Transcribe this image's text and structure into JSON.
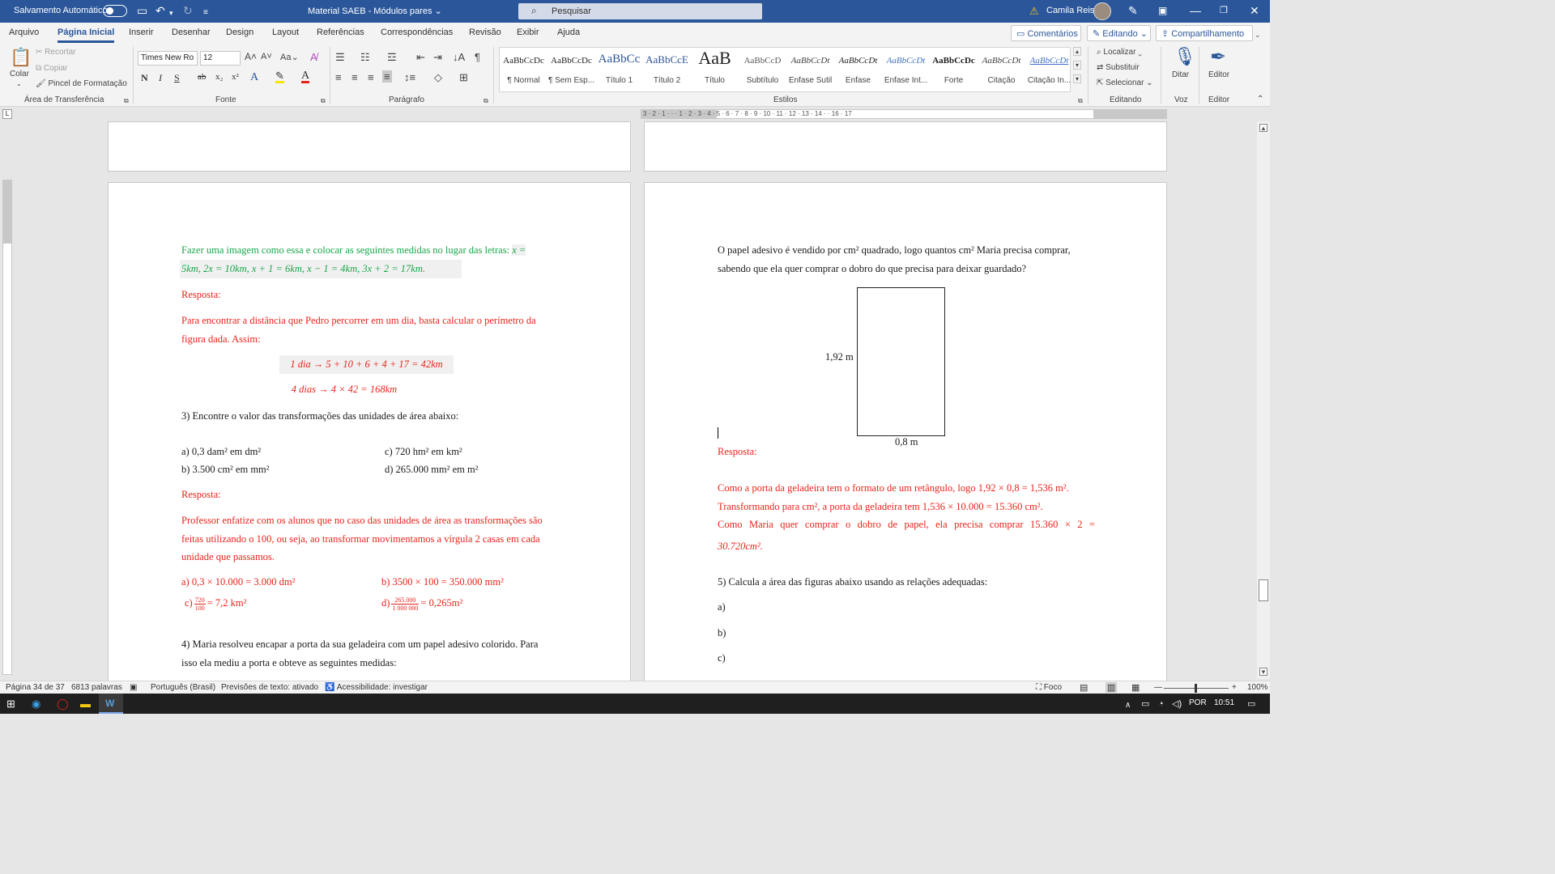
{
  "titlebar": {
    "autosave_label": "Salvamento Automático",
    "doc_title": "Material SAEB - Módulos pares",
    "search_placeholder": "Pesquisar",
    "user_name": "Camila Reis"
  },
  "menu": {
    "tabs": [
      "Arquivo",
      "Página Inicial",
      "Inserir",
      "Desenhar",
      "Design",
      "Layout",
      "Referências",
      "Correspondências",
      "Revisão",
      "Exibir",
      "Ajuda"
    ],
    "comments_label": "Comentários",
    "editing_label": "Editando",
    "share_label": "Compartilhamento"
  },
  "ribbon": {
    "clipboard": {
      "paste": "Colar",
      "cut": "Recortar",
      "copy": "Copiar",
      "format_painter": "Pincel de Formatação",
      "group": "Área de Transferência"
    },
    "font": {
      "family": "Times New Ro",
      "size": "12",
      "group": "Fonte"
    },
    "paragraph": {
      "group": "Parágrafo"
    },
    "styles": {
      "group": "Estilos",
      "items": [
        {
          "preview": "AaBbCcDc",
          "name": "¶ Normal"
        },
        {
          "preview": "AaBbCcDc",
          "name": "¶ Sem Esp..."
        },
        {
          "preview": "AaBbCc",
          "name": "Título 1"
        },
        {
          "preview": "AaBbCcE",
          "name": "Título 2"
        },
        {
          "preview": "AaB",
          "name": "Título"
        },
        {
          "preview": "AaBbCcD",
          "name": "Subtítulo"
        },
        {
          "preview": "AaBbCcDt",
          "name": "Ênfase Sutil"
        },
        {
          "preview": "AaBbCcDt",
          "name": "Ênfase"
        },
        {
          "preview": "AaBbCcDt",
          "name": "Ênfase Int..."
        },
        {
          "preview": "AaBbCcDc",
          "name": "Forte"
        },
        {
          "preview": "AaBbCcDt",
          "name": "Citação"
        },
        {
          "preview": "AaBbCcDt",
          "name": "Citação In..."
        }
      ]
    },
    "editing": {
      "find": "Localizar",
      "replace": "Substituir",
      "select": "Selecionar",
      "group": "Editando"
    },
    "voice": {
      "dictate": "Ditar",
      "group": "Voz"
    },
    "editor": {
      "label": "Editor",
      "group": "Editor"
    }
  },
  "left_page": {
    "p1_text": "Fazer uma imagem como essa e colocar as seguintes medidas no lugar das letras: ",
    "p1_math_a": "x =",
    "p1_math_b": "5km, 2x = 10km, x + 1 = 6km, x − 1 = 4km, 3x + 2 = 17km.",
    "resposta1": "Resposta:",
    "p2_line1": "Para encontrar a distância que Pedro percorrer em um dia, basta calcular o perímetro da",
    "p2_line2": "figura dada. Assim:",
    "eq1": "1 dia → 5 + 10 + 6 + 4 + 17 = 42km",
    "eq2": "4 dias → 4 × 42 = 168km",
    "q3": "3) Encontre o valor das transformações das unidades de área abaixo:",
    "q3a": "a) 0,3 dam² em dm²",
    "q3b": "b) 3.500 cm² em mm²",
    "q3c": "c) 720 hm² em km²",
    "q3d": "d) 265.000 mm² em m²",
    "resposta2": "Resposta:",
    "p3_line1": "Professor enfatize com os alunos que no caso das unidades de área as transformações são",
    "p3_line2": "feitas utilizando o 100, ou seja, ao transformar movimentamos a vírgula 2 casas em cada",
    "p3_line3": "unidade que passamos.",
    "ans_a": "a) 0,3 × 10.000 = 3.000 dm²",
    "ans_b": "b) 3500 × 100 = 350.000 mm²",
    "ans_c_prefix": "c)",
    "ans_c_num": "720",
    "ans_c_den": "100",
    "ans_c_result": "= 7,2 km²",
    "ans_d_prefix": "d)",
    "ans_d_num": "265.000",
    "ans_d_den": "1 000 000",
    "ans_d_result": "= 0,265m²",
    "q4_line1": "4) Maria resolveu encapar a porta da sua geladeira com um papel adesivo colorido. Para",
    "q4_line2": "isso ela mediu a porta e obteve as seguintes medidas:"
  },
  "right_page": {
    "p1_line1": "O papel adesivo é vendido por cm² quadrado, logo quantos cm² Maria precisa comprar,",
    "p1_line2": "sabendo que ela quer comprar o dobro do que precisa para deixar guardado?",
    "fig_height": "1,92 m",
    "fig_width": "0,8 m",
    "resposta": "Resposta:",
    "ans_line1": "Como a porta da geladeira tem o formato de um retângulo, logo 1,92 × 0,8 = 1,536 m².",
    "ans_line2": "Transformando para cm², a porta da geladeira tem 1,536 × 10.000 = 15.360 cm².",
    "ans_line3": "Como Maria quer comprar o dobro de papel, ela precisa comprar 15.360 × 2 =",
    "ans_line4": "30.720cm².",
    "q5": "5) Calcula a área das figuras abaixo usando as relações adequadas:",
    "q5a": "a)",
    "q5b": "b)",
    "q5c": "c)"
  },
  "statusbar": {
    "page": "Página 34 de 37",
    "words": "6813 palavras",
    "language": "Português (Brasil)",
    "predictions": "Previsões de texto: ativado",
    "accessibility": "Acessibilidade: investigar",
    "focus": "Foco",
    "zoom": "100%"
  },
  "taskbar": {
    "lang": "POR",
    "time": "10:51"
  },
  "ruler": {
    "h_numbers": "3 · 2 · 1 · · · 1 · 2 · 3 · 4 · 5 · 6 · 7 · 8 · 9 · 10 · 11 · 12 · 13 · 14 · · 16 · 17"
  },
  "colors": {
    "word_blue": "#2b579a",
    "answer_red": "#e8231b",
    "instruction_green": "#1aa64a"
  }
}
